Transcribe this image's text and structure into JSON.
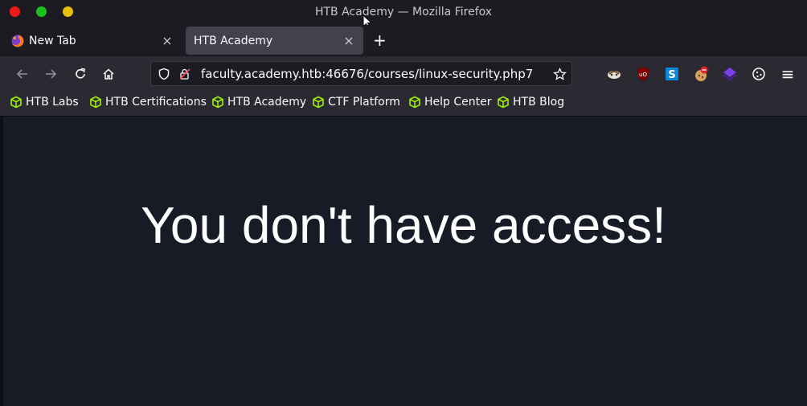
{
  "window": {
    "title": "HTB Academy — Mozilla Firefox"
  },
  "tabs": [
    {
      "label": "New Tab",
      "close": "×"
    },
    {
      "label": "HTB Academy",
      "close": "×"
    }
  ],
  "tabstrip": {
    "new_tab": "+"
  },
  "navbar": {
    "url": "faculty.academy.htb:46676/courses/linux-security.php7",
    "menu": "≡"
  },
  "bookmarks": [
    {
      "label": "HTB Labs"
    },
    {
      "label": "HTB Certifications"
    },
    {
      "label": "HTB Academy"
    },
    {
      "label": "CTF Platform"
    },
    {
      "label": "Help Center"
    },
    {
      "label": "HTB Blog"
    }
  ],
  "page": {
    "message": "You don't have access!"
  },
  "colors": {
    "accent_bookmark": "#9fef00",
    "page_background": "#161b25"
  }
}
